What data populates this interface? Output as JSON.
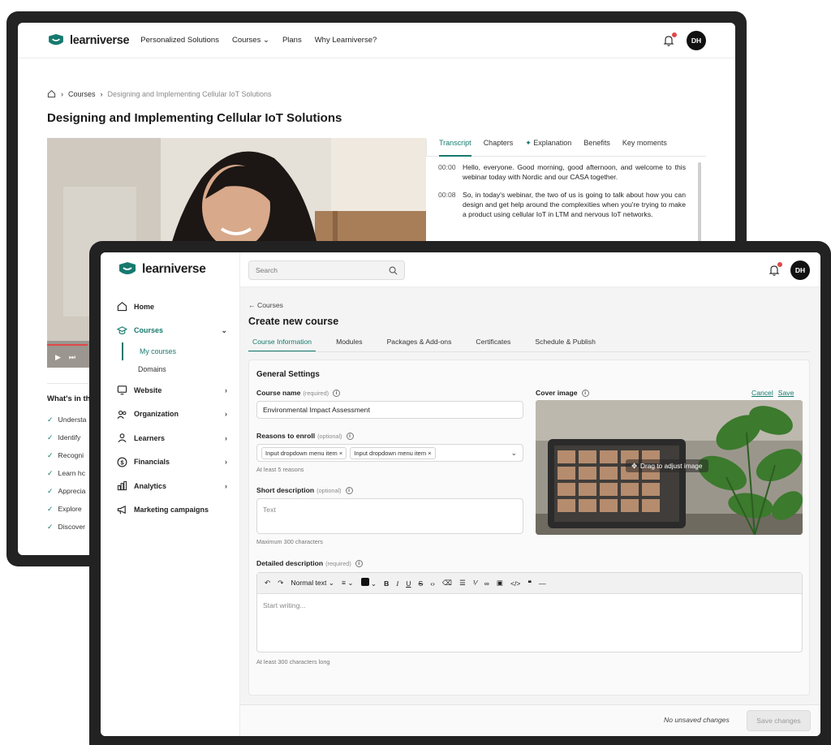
{
  "brand": {
    "name": "learniverse",
    "accent": "#167a6e"
  },
  "back_window": {
    "nav": {
      "links": [
        "Personalized Solutions",
        "Courses",
        "Plans",
        "Why Learniverse?"
      ],
      "avatar_initials": "DH"
    },
    "breadcrumb": {
      "item1": "Courses",
      "item2": "Designing and Implementing Cellular IoT Solutions"
    },
    "title": "Designing and Implementing Cellular IoT Solutions",
    "tabs": {
      "transcript": "Transcript",
      "chapters": "Chapters",
      "explanation": "Explanation",
      "benefits": "Benefits",
      "key_moments": "Key moments"
    },
    "transcript": [
      {
        "time": "00:00",
        "text": "Hello, everyone. Good morning, good afternoon, and welcome to this webinar today with Nordic and our CASA together."
      },
      {
        "time": "00:08",
        "text": "So, in today's webinar, the two of us is going to talk about how you can design and get help around the complexities when you're trying to make a product using cellular IoT in LTM and nervous IoT networks."
      }
    ],
    "learn_heading": "What's in th",
    "learn_items": [
      "Understa",
      "Identify",
      "Recogni",
      "Learn hc",
      "Apprecia",
      "Explore",
      "Discover"
    ]
  },
  "front_window": {
    "search_placeholder": "Search",
    "avatar_initials": "DH",
    "sidebar": {
      "home": "Home",
      "courses": "Courses",
      "my_courses": "My courses",
      "domains": "Domains",
      "website": "Website",
      "organization": "Organization",
      "learners": "Learners",
      "financials": "Financials",
      "analytics": "Analytics",
      "marketing": "Marketing campaigns"
    },
    "back_link": "← Courses",
    "page_title": "Create new course",
    "tabs": {
      "course_information": "Course Information",
      "modules": "Modules",
      "packages": "Packages & Add-ons",
      "certificates": "Certificates",
      "schedule": "Schedule & Publish"
    },
    "form": {
      "section_title": "General Settings",
      "course_name_label": "Course name",
      "course_name_hint": "(required)",
      "course_name_value": "Environmental Impact Assessment",
      "reasons_label": "Reasons to enroll",
      "reasons_hint": "(optional)",
      "reasons_chips": [
        "Input dropdown menu item",
        "Input dropdown menu item"
      ],
      "reasons_helper": "At least 5 reasons",
      "short_desc_label": "Short description",
      "short_desc_hint": "(optional)",
      "short_desc_placeholder": "Text",
      "short_desc_helper": "Maximum 300 characters",
      "cover_label": "Cover image",
      "cover_cancel": "Cancel",
      "cover_save": "Save",
      "cover_drag": "Drag to adjust image",
      "detailed_label": "Detailed description",
      "detailed_hint": "(required)",
      "editor_format": "Normal text",
      "editor_placeholder": "Start writing...",
      "detailed_helper": "At least 300 characters long"
    },
    "footer": {
      "status": "No unsaved changes",
      "save_button": "Save changes"
    }
  }
}
